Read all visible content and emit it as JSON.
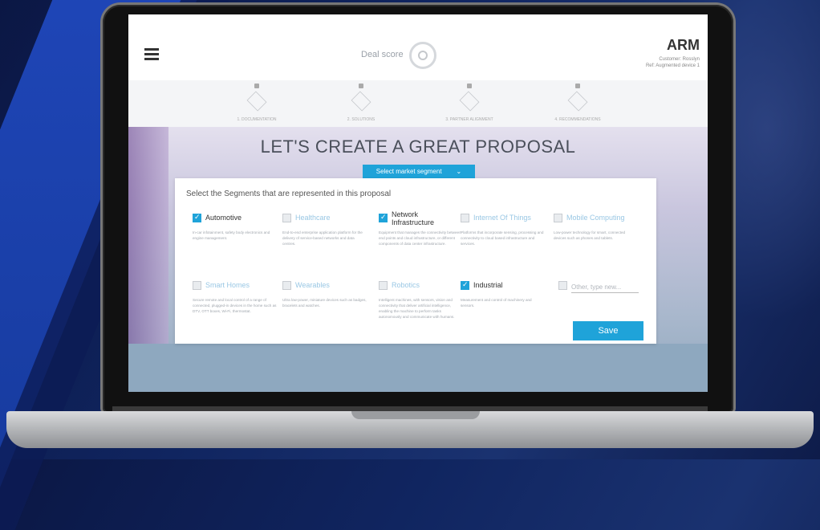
{
  "app": {
    "logo": "ARM",
    "customer_line": "Customer: Rosslyn",
    "ref_line": "Ref: Augmented device 1",
    "deal_score_label": "Deal score"
  },
  "stepper": {
    "steps": [
      {
        "label": "1. DOCUMENTATION"
      },
      {
        "label": "2. SOLUTIONS"
      },
      {
        "label": "3. PARTNER ALIGNMENT"
      },
      {
        "label": "4. RECOMMENDATIONS"
      }
    ]
  },
  "hero": {
    "title": "LET'S CREATE A GREAT PROPOSAL",
    "segment_button": "Select market segment",
    "segment_chevron": "⌄"
  },
  "panel": {
    "title": "Select the Segments that are represented in this proposal",
    "segments": [
      {
        "name": "Automotive",
        "checked": true,
        "desc": "In-car infotainment, safety body electronics and engine management."
      },
      {
        "name": "Healthcare",
        "checked": false,
        "desc": "End-to-end enterprise application platform for the delivery of service-based networks and data centres."
      },
      {
        "name": "Network Infrastructure",
        "checked": true,
        "desc": "Equipment that manages the connectivity between end points and cloud infrastructure, or different components of data center infrastructure."
      },
      {
        "name": "Internet Of Things",
        "checked": false,
        "desc": "Platforms that incorporate sensing, processing and connectivity to cloud based infrastructure and services."
      },
      {
        "name": "Mobile Computing",
        "checked": false,
        "desc": "Low-power technology for smart, connected devices such as phones and tablets."
      },
      {
        "name": "Smart Homes",
        "checked": false,
        "desc": "Secure remote and local control of a range of connected, plugged-in devices in the home such as DTV, OTT boxes, Wi-Fi, thermostat."
      },
      {
        "name": "Wearables",
        "checked": false,
        "desc": "Ultra low-power, miniature devices such as badges, bracelets and watches."
      },
      {
        "name": "Robotics",
        "checked": false,
        "desc": "Intelligent machines, with sensors, vision and connectivity that deliver artificial intelligence, enabling the machine to perform tasks autonomously and communicate with humans."
      },
      {
        "name": "Industrial",
        "checked": true,
        "desc": "Measurement and control of machinery and sensors."
      }
    ],
    "other_placeholder": "Other, type new...",
    "save_label": "Save"
  },
  "colors": {
    "accent": "#1fa3d9",
    "background": "#102560"
  }
}
